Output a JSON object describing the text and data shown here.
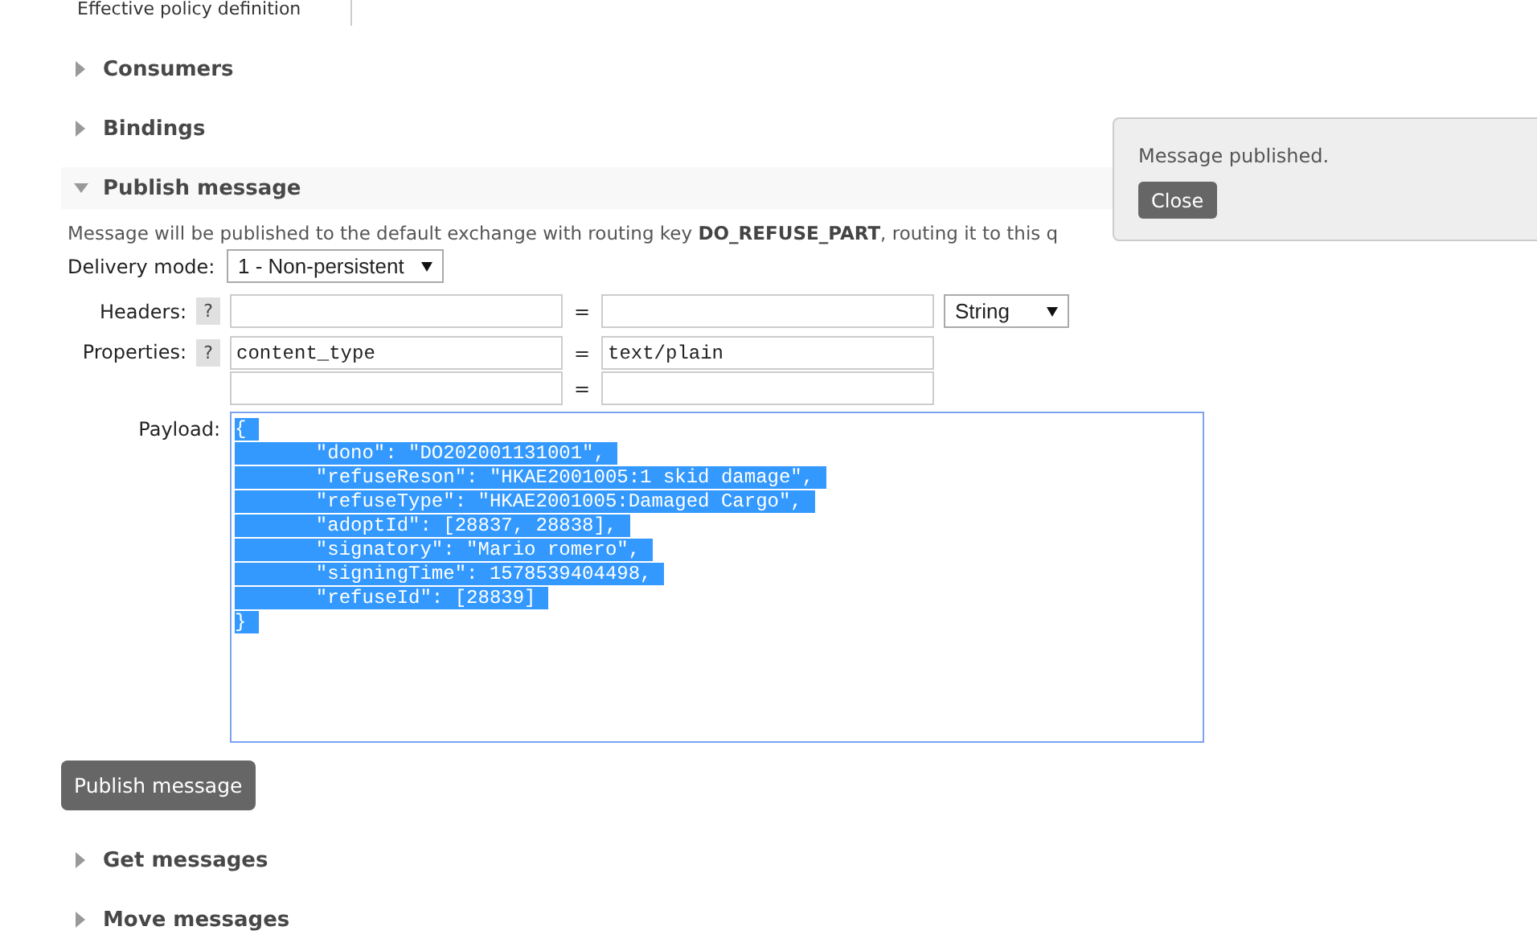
{
  "top_tab": {
    "label": "Effective policy definition"
  },
  "sections": [
    {
      "title": "Consumers",
      "expanded": false
    },
    {
      "title": "Bindings",
      "expanded": false
    },
    {
      "title": "Publish message",
      "expanded": true,
      "form": {
        "description": "Message will be published to the default exchange with routing key **DO_REFUSE_PART**, routing it to this q",
        "delivery_mode": {
          "label": "Delivery mode:",
          "value": "1 - Non-persistent"
        },
        "headers": {
          "label": "Headers:",
          "help": "?",
          "equals": "=",
          "type": "String",
          "rows": [
            {
              "key": "",
              "value": ""
            }
          ]
        },
        "properties": {
          "label": "Properties:",
          "help": "?",
          "rows": [
            {
              "key": "content_type",
              "value": "text/plain",
              "equals": "="
            },
            {
              "key": "",
              "value": "",
              "equals": "="
            }
          ]
        },
        "payload": {
          "label": "Payload:",
          "selected": true,
          "lines": [
            "{",
            "\t\"dono\": \"DO202001131001\",",
            "\t\"refuseReson\": \"HKAE2001005:1 skid damage\",",
            "\t\"refuseType\": \"HKAE2001005:Damaged Cargo\",",
            "\t\"adoptId\": [28837, 28838],",
            "\t\"signatory\": \"Mario romero\",",
            "\t\"signingTime\": 1578539404498,",
            "\t\"refuseId\": [28839]",
            "}"
          ]
        },
        "submit": "Publish message"
      }
    },
    {
      "title": "Get messages",
      "expanded": false
    },
    {
      "title": "Move messages",
      "expanded": false
    }
  ],
  "notification": {
    "message": "Message published.",
    "button": "Close"
  }
}
